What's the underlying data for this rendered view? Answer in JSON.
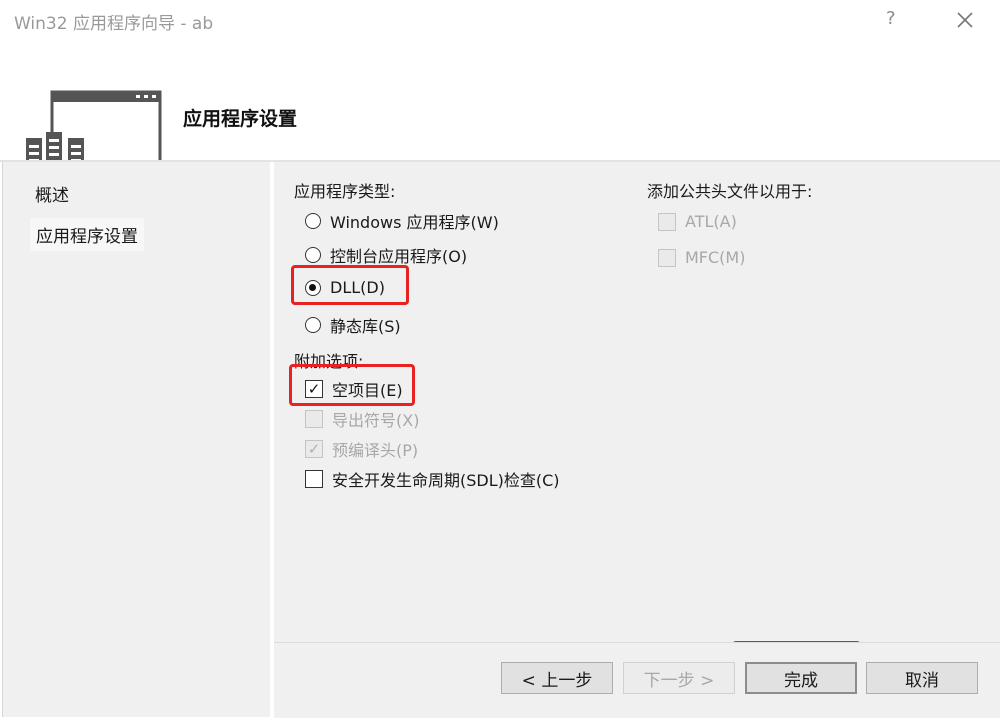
{
  "window": {
    "title": "Win32 应用程序向导 - ab",
    "help_label": "?",
    "close_icon": "close-icon"
  },
  "header": {
    "title": "应用程序设置",
    "icon": "app-settings-icon"
  },
  "sidebar": {
    "items": [
      {
        "label": "概述",
        "selected": false
      },
      {
        "label": "应用程序设置",
        "selected": true
      }
    ]
  },
  "app_type": {
    "label": "应用程序类型:",
    "options": [
      {
        "label": "Windows 应用程序(W)",
        "checked": false
      },
      {
        "label": "控制台应用程序(O)",
        "checked": false
      },
      {
        "label": "DLL(D)",
        "checked": true
      },
      {
        "label": "静态库(S)",
        "checked": false
      }
    ]
  },
  "extra_options": {
    "label": "附加选项:",
    "options": [
      {
        "label": "空项目(E)",
        "checked": true,
        "enabled": true
      },
      {
        "label": "导出符号(X)",
        "checked": false,
        "enabled": false
      },
      {
        "label": "预编译头(P)",
        "checked": true,
        "enabled": false
      },
      {
        "label": "安全开发生命周期(SDL)检查(C)",
        "checked": false,
        "enabled": true
      }
    ]
  },
  "common_headers": {
    "label": "添加公共头文件以用于:",
    "options": [
      {
        "label": "ATL(A)",
        "checked": false,
        "enabled": false
      },
      {
        "label": "MFC(M)",
        "checked": false,
        "enabled": false
      }
    ]
  },
  "buttons": {
    "prev": "< 上一步",
    "next": "下一步 >",
    "finish": "完成",
    "cancel": "取消"
  },
  "colors": {
    "highlight": "#e62222",
    "panel_bg": "#f0f0f0"
  }
}
